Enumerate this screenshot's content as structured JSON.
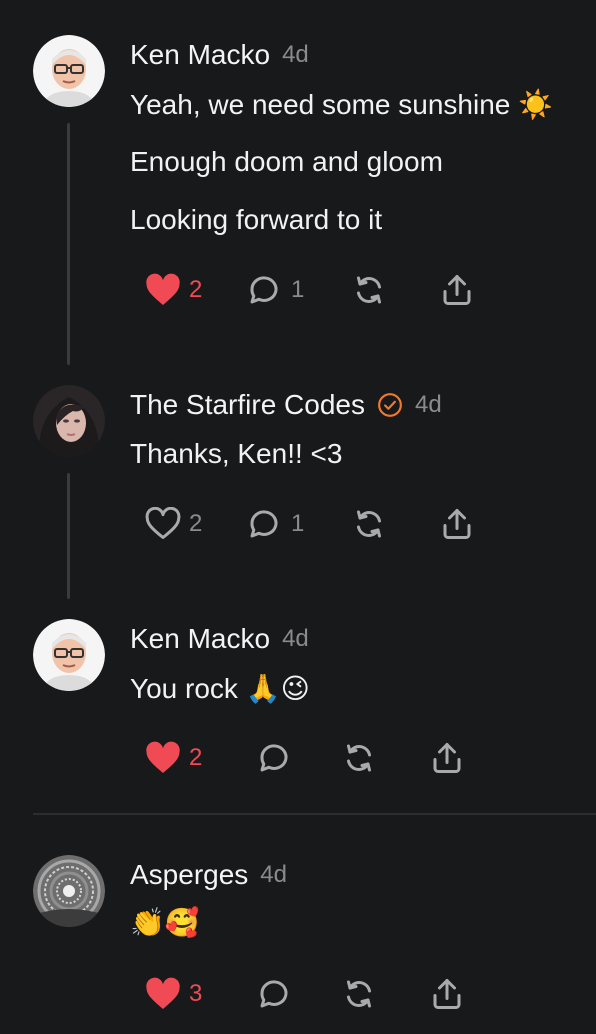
{
  "posts": [
    {
      "author": "Ken Macko",
      "time": "4d",
      "lines": [
        "Yeah, we need some sunshine ☀️",
        "Enough doom and gloom",
        "Looking forward to it"
      ],
      "liked": true,
      "likes": "2",
      "replies": "1"
    },
    {
      "author": "The Starfire Codes",
      "verified": true,
      "time": "4d",
      "lines": [
        "Thanks, Ken!! <3"
      ],
      "liked": false,
      "likes": "2",
      "replies": "1"
    },
    {
      "author": "Ken Macko",
      "time": "4d",
      "lines": [
        "You rock 🙏😉"
      ],
      "liked": true,
      "likes": "2",
      "replies": ""
    },
    {
      "author": "Asperges",
      "time": "4d",
      "lines": [
        "👏🥰"
      ],
      "liked": true,
      "likes": "3",
      "replies": ""
    }
  ],
  "colors": {
    "like_active": "#f04a55",
    "icon": "#a9aaad",
    "verified": "#f07a2a"
  },
  "icons": [
    "heart-icon",
    "comment-icon",
    "repost-icon",
    "share-icon"
  ]
}
